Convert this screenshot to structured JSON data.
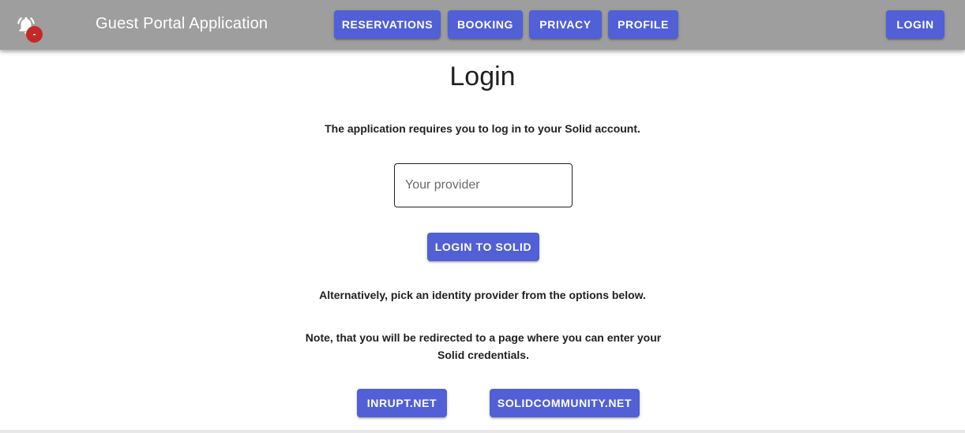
{
  "appbar": {
    "notification_badge": "-",
    "title": "Guest Portal Application",
    "nav": {
      "reservations": "RESERVATIONS",
      "booking": "BOOKING",
      "privacy": "PRIVACY",
      "profile": "PROFILE"
    },
    "login": "LOGIN"
  },
  "main": {
    "title": "Login",
    "intro": "The application requires you to log in to your Solid account.",
    "provider_placeholder": "Your provider",
    "login_to_solid": "LOGIN TO SOLID",
    "alternative_text": "Alternatively, pick an identity provider from the options below.",
    "note_text": "Note, that you will be redirected to a page where you can enter your Solid credentials.",
    "providers": {
      "inrupt": "INRUPT.NET",
      "solidcommunity": "SOLIDCOMMUNITY.NET"
    }
  },
  "colors": {
    "appbar": "#9e9e9e",
    "primary_button": "#5160d6",
    "badge": "#c62828"
  },
  "icons": {
    "notifications": "bell-ringing-icon"
  }
}
